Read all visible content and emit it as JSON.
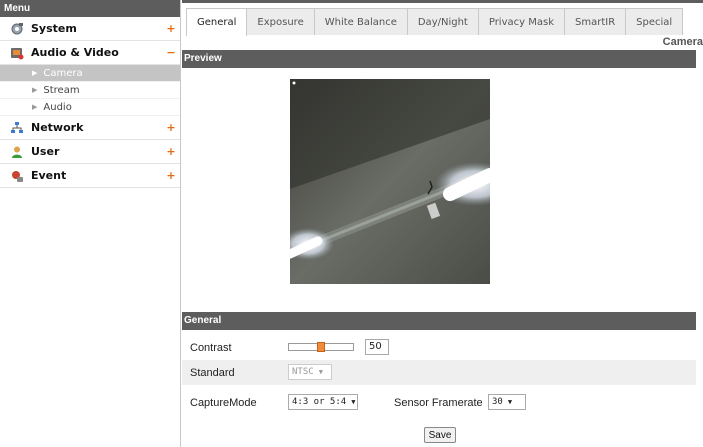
{
  "sidebar": {
    "menu_header": "Menu",
    "items": [
      {
        "label": "System",
        "toggle": "+",
        "icon": "system-icon"
      },
      {
        "label": "Audio & Video",
        "toggle": "−",
        "icon": "audio-video-icon"
      },
      {
        "label": "Network",
        "toggle": "+",
        "icon": "network-icon"
      },
      {
        "label": "User",
        "toggle": "+",
        "icon": "user-icon"
      },
      {
        "label": "Event",
        "toggle": "+",
        "icon": "event-icon"
      }
    ],
    "sub_items": [
      {
        "label": "Camera",
        "active": true
      },
      {
        "label": "Stream",
        "active": false
      },
      {
        "label": "Audio",
        "active": false
      }
    ]
  },
  "tabs": [
    "General",
    "Exposure",
    "White Balance",
    "Day/Night",
    "Privacy Mask",
    "SmartIR",
    "Special"
  ],
  "active_tab": "General",
  "page_title": "Camera",
  "sections": {
    "preview": "Preview",
    "general": "General"
  },
  "general": {
    "contrast_label": "Contrast",
    "contrast_value": "50",
    "contrast_fraction": 0.5,
    "standard_label": "Standard",
    "standard_value": "NTSC",
    "capture_label": "CaptureMode",
    "capture_value": "4:3 or 5:4",
    "framerate_label": "Sensor Framerate",
    "framerate_value": "30",
    "save_label": "Save"
  },
  "colors": {
    "header_bar": "#5d5d5d",
    "accent": "#e66a10",
    "active_sub": "#c4c4c4"
  }
}
